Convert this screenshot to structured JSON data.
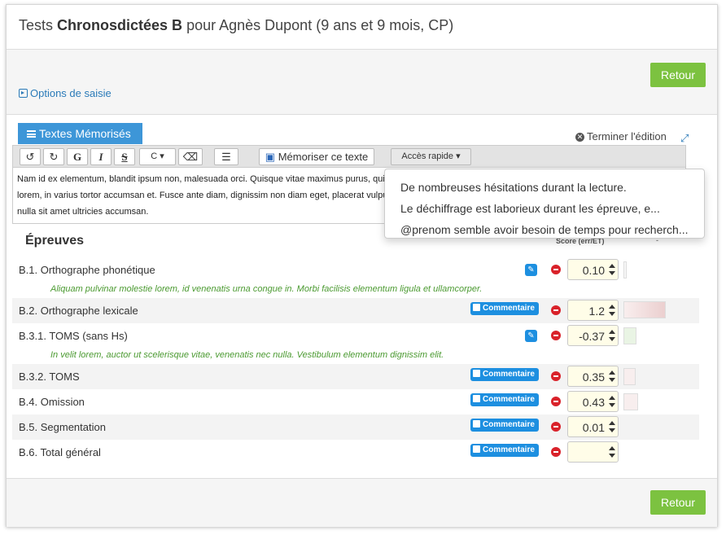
{
  "header": {
    "prefix": "Tests",
    "test_name": "Chronosdictées B",
    "suffix": "pour Agnès Dupont (9 ans et 9 mois, CP)"
  },
  "topbar": {
    "back_label": "Retour",
    "options_label": "Options de saisie"
  },
  "editor": {
    "tab_label": "Textes Mémorisés",
    "finish_label": "Terminer l'édition",
    "toolbar": {
      "undo": "↺",
      "redo": "↻",
      "bold": "G",
      "italic": "I",
      "strike": "S",
      "color": "C",
      "save_label": "Mémoriser ce texte",
      "quick_access_label": "Accès rapide"
    },
    "content_lines": [
      "Nam id ex elementum, blandit ipsum non, malesuada orci. Quisque vitae maximus purus, quis",
      "lorem, in varius tortor accumsan et. Fusce ante diam, dignissim non diam eget, placerat vulpu",
      "nulla sit amet ultricies accumsan."
    ],
    "quick_access_items": [
      "De nombreuses hésitations durant la lecture.",
      "Le déchiffrage est laborieux durant les épreuve, e...",
      "@prenom semble avoir besoin de temps pour recherch..."
    ]
  },
  "epreuves": {
    "title": "Épreuves",
    "score_header": "Score (err/ET)",
    "dash": "-",
    "comment_button_label": "Commentaire",
    "rows": [
      {
        "label": "B.1. Orthographe phonétique",
        "score": "0.10",
        "comment": "Aliquam pulvinar molestie lorem, id venenatis urna congue in. Morbi facilisis elementum ligula et ullamcorper.",
        "button": "pencil"
      },
      {
        "label": "B.2. Orthographe lexicale",
        "score": "1.2",
        "button": "comment"
      },
      {
        "label": "B.3.1. TOMS (sans Hs)",
        "score": "-0.37",
        "comment": "In velit lorem, auctor ut scelerisque vitae, venenatis nec nulla. Vestibulum elementum dignissim elit.",
        "button": "pencil"
      },
      {
        "label": "B.3.2. TOMS",
        "score": "0.35",
        "button": "comment"
      },
      {
        "label": "B.4. Omission",
        "score": "0.43",
        "button": "comment"
      },
      {
        "label": "B.5. Segmentation",
        "score": "0.01",
        "button": "comment"
      },
      {
        "label": "B.6. Total général",
        "score": "",
        "button": "comment"
      }
    ]
  },
  "footer": {
    "back_label": "Retour"
  }
}
